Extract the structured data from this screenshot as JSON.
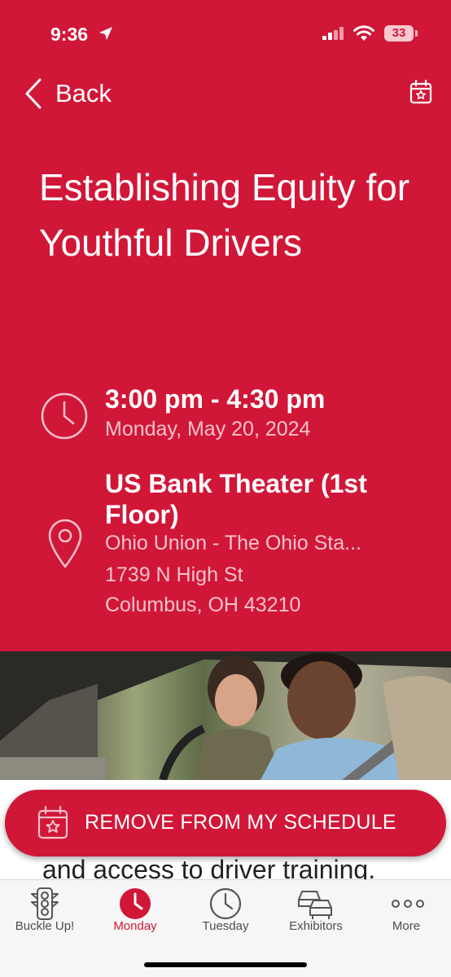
{
  "status_bar": {
    "time": "9:36",
    "battery": "33"
  },
  "header": {
    "back_label": "Back"
  },
  "session": {
    "title": "Establishing Equity for Youthful Drivers",
    "time_range": "3:00 pm - 4:30 pm",
    "date": "Monday, May 20, 2024",
    "venue": "US Bank Theater (1st Floor)",
    "location_name": "Ohio Union - The Ohio Sta...",
    "address_line1": "1739 N High St",
    "address_line2": "Columbus, OH 43210"
  },
  "action": {
    "remove_label": "REMOVE FROM MY SCHEDULE"
  },
  "body": {
    "partial_text": "and access to driver training."
  },
  "tabs": [
    {
      "label": "Buckle Up!",
      "icon": "traffic-light-icon",
      "active": false
    },
    {
      "label": "Monday",
      "icon": "clock-icon",
      "active": true
    },
    {
      "label": "Tuesday",
      "icon": "clock-icon",
      "active": false
    },
    {
      "label": "Exhibitors",
      "icon": "cars-icon",
      "active": false
    },
    {
      "label": "More",
      "icon": "more-dots-icon",
      "active": false
    }
  ],
  "colors": {
    "brand_red": "#d11738",
    "tab_inactive": "#4d4d4d"
  }
}
